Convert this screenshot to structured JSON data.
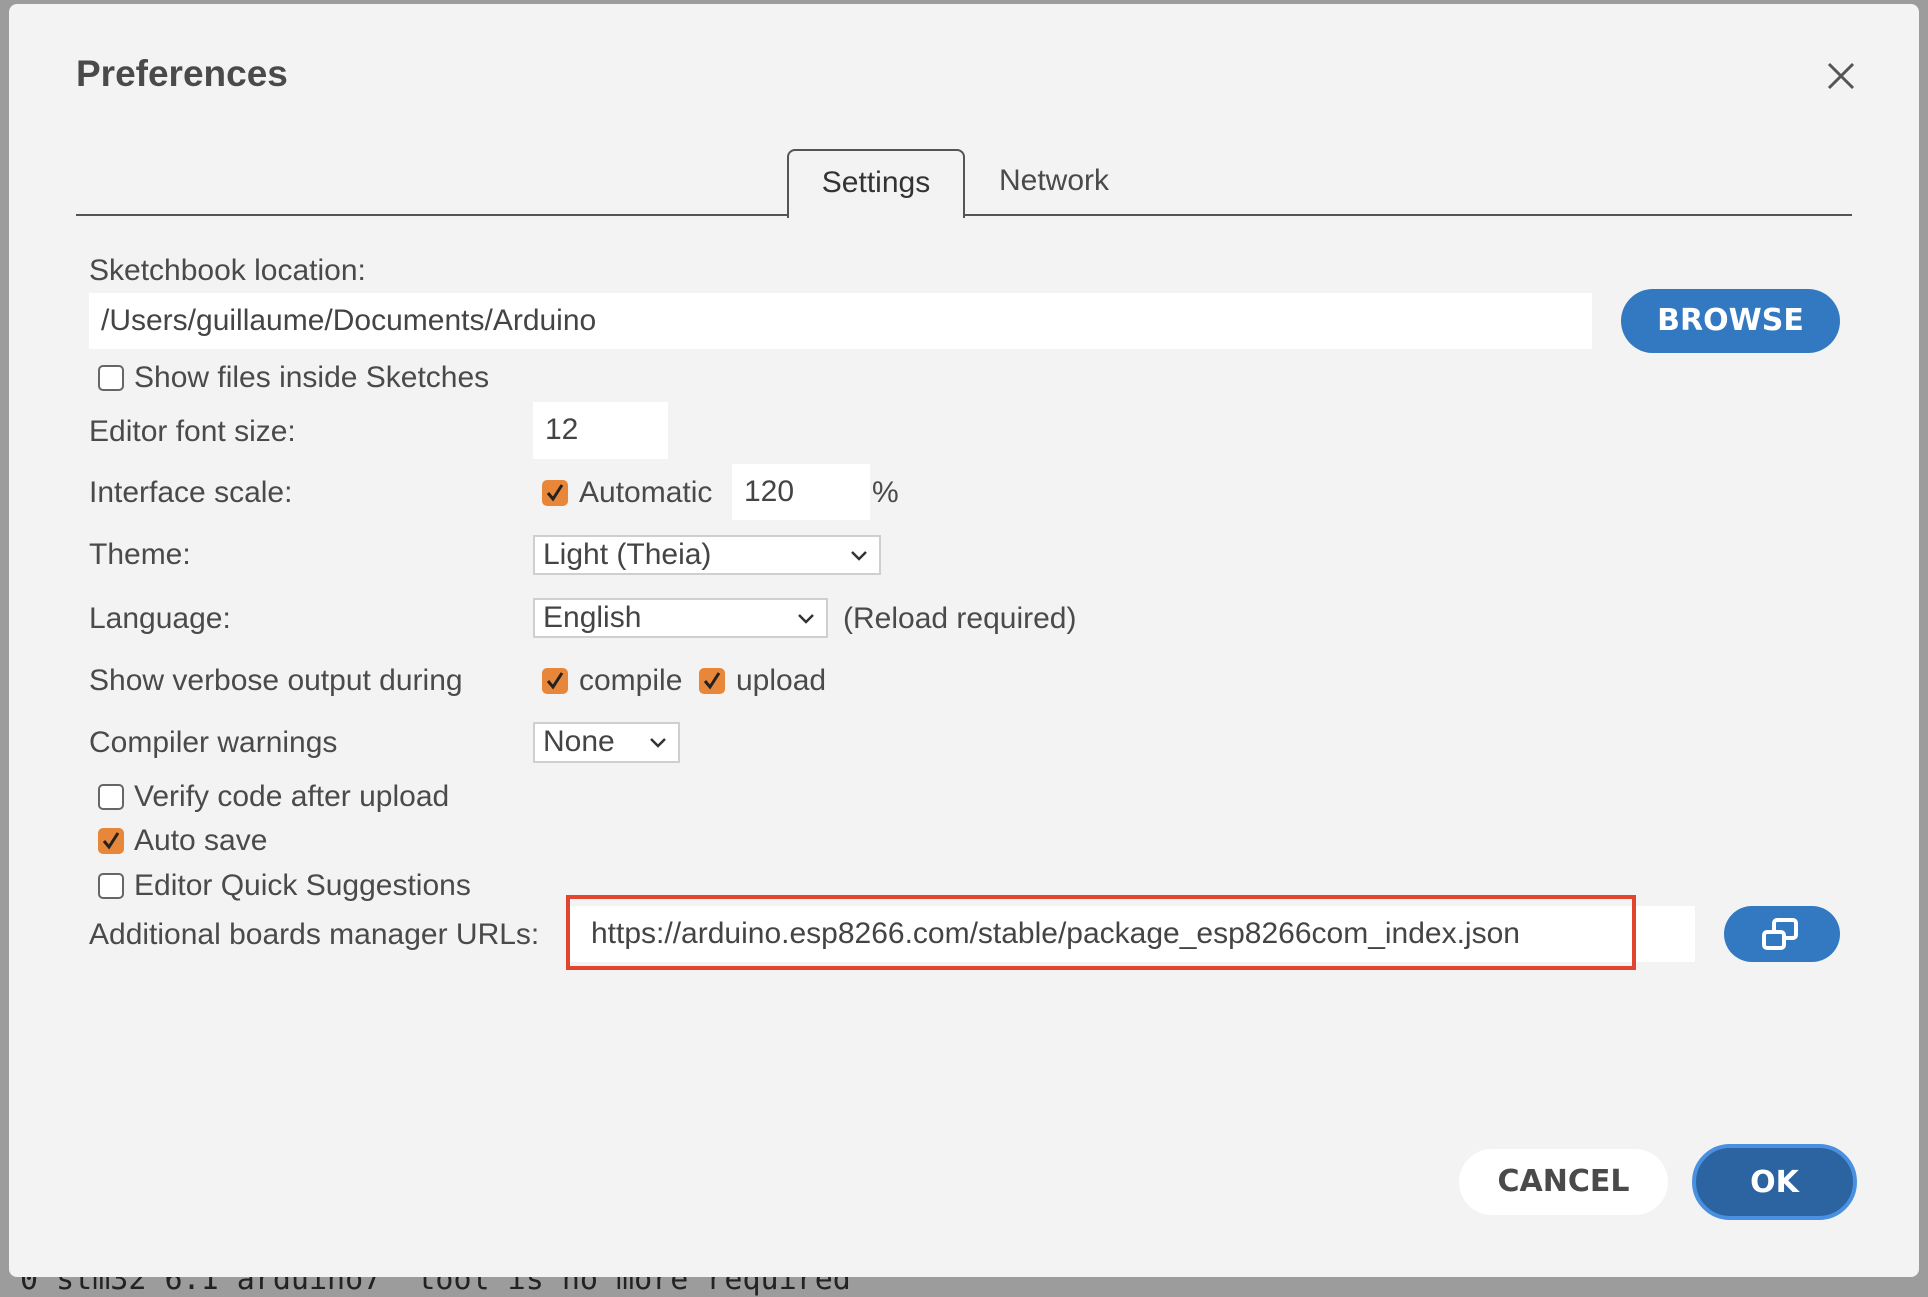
{
  "background": {
    "console_text": "0 stm32 6.1 arduino7  tool is no more required"
  },
  "dialog": {
    "title": "Preferences",
    "close_icon": "close-icon",
    "tabs": [
      {
        "label": "Settings",
        "active": true
      },
      {
        "label": "Network",
        "active": false
      }
    ]
  },
  "settings": {
    "sketchbook_label": "Sketchbook location:",
    "sketchbook_value": "/Users/guillaume/Documents/Arduino",
    "browse_label": "BROWSE",
    "show_files_label": "Show files inside Sketches",
    "show_files_checked": false,
    "font_size_label": "Editor font size:",
    "font_size_value": "12",
    "interface_scale_label": "Interface scale:",
    "automatic_label": "Automatic",
    "automatic_checked": true,
    "scale_value": "120",
    "percent": "%",
    "theme_label": "Theme:",
    "theme_value": "Light (Theia)",
    "language_label": "Language:",
    "language_value": "English",
    "reload_note": "(Reload required)",
    "verbose_label": "Show verbose output during",
    "compile_label": "compile",
    "compile_checked": true,
    "upload_label": "upload",
    "upload_checked": true,
    "warnings_label": "Compiler warnings",
    "warnings_value": "None",
    "verify_label": "Verify code after upload",
    "verify_checked": false,
    "autosave_label": "Auto save",
    "autosave_checked": true,
    "quick_suggestions_label": "Editor Quick Suggestions",
    "quick_suggestions_checked": false,
    "boards_urls_label": "Additional boards manager URLs:",
    "boards_urls_value": "https://arduino.esp8266.com/stable/package_esp8266com_index.json"
  },
  "footer": {
    "cancel_label": "CANCEL",
    "ok_label": "OK"
  },
  "colors": {
    "accent": "#3279c2",
    "ok": "#2b64a0",
    "checkbox": "#e8873a",
    "highlight": "#e14530"
  }
}
